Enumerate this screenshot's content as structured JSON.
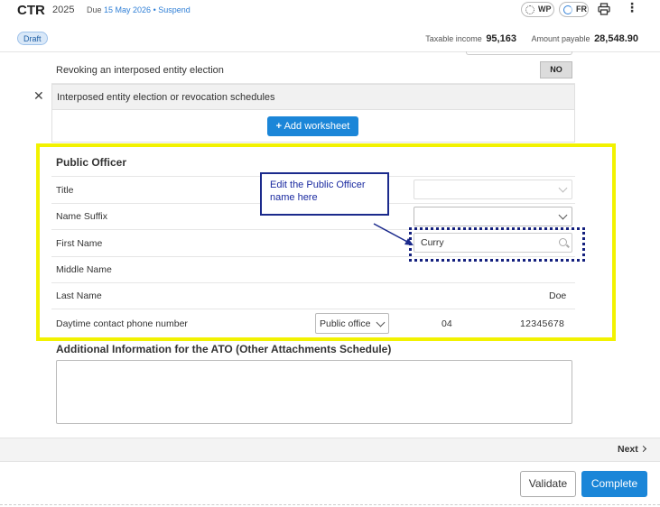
{
  "header": {
    "form_code": "CTR",
    "year": "2025",
    "due_prefix": "Due",
    "due_date": "15 May 2026",
    "separator": "•",
    "suspend_label": "Suspend",
    "pills": [
      {
        "label": "WP",
        "icon": "loading-circle-icon"
      },
      {
        "label": "FR",
        "icon": "status-circle-icon"
      }
    ],
    "status_badge": "Draft",
    "taxable_income_label": "Taxable income",
    "taxable_income_value": "95,163",
    "amount_payable_label": "Amount payable",
    "amount_payable_value": "28,548.90"
  },
  "rows": {
    "revoking_label": "Revoking an interposed entity election",
    "revoking_value": "NO",
    "schedule_label": "Interposed entity election or revocation schedules",
    "add_worksheet_label": "Add worksheet"
  },
  "public_officer": {
    "section_title": "Public Officer",
    "title_label": "Title",
    "title_value": "",
    "suffix_label": "Name Suffix",
    "suffix_value": "",
    "first_name_label": "First Name",
    "first_name_value": "Curry",
    "middle_name_label": "Middle Name",
    "middle_name_value": "",
    "last_name_label": "Last Name",
    "last_name_value": "Doe",
    "phone_label": "Daytime contact phone number",
    "phone_type_value": "Public office",
    "phone_area_code": "04",
    "phone_number": "12345678"
  },
  "callout": {
    "text": "Edit the Public Officer name here"
  },
  "additional_info": {
    "title": "Additional Information for the ATO (Other Attachments Schedule)",
    "value": ""
  },
  "footer": {
    "next_label": "Next",
    "validate_label": "Validate",
    "complete_label": "Complete"
  },
  "colors": {
    "accent": "#1b86d8",
    "highlight": "#f2f200",
    "annotation": "#14207e"
  }
}
